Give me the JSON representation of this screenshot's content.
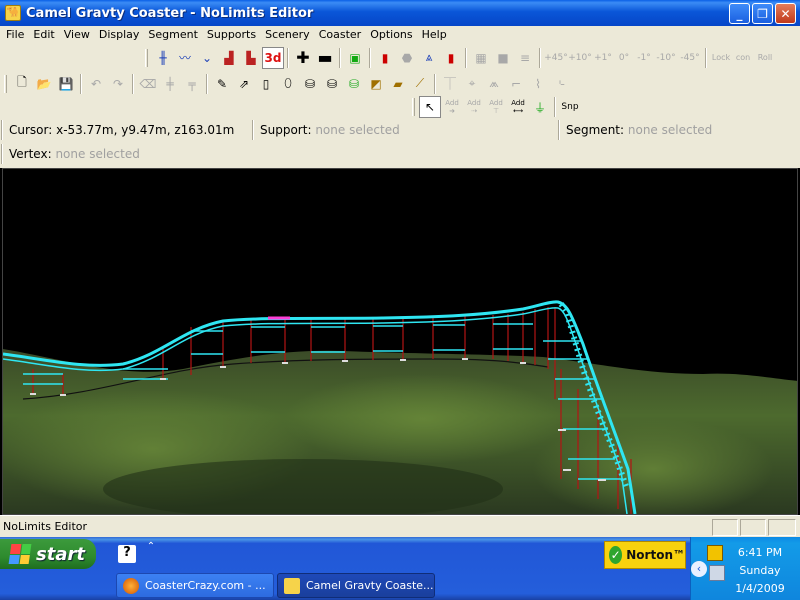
{
  "window": {
    "title": "Camel Gravty Coaster - NoLimits Editor",
    "controls": {
      "minimize": "_",
      "maximize": "❐",
      "close": "✕"
    }
  },
  "menu": {
    "items": [
      "File",
      "Edit",
      "View",
      "Display",
      "Segment",
      "Supports",
      "Scenery",
      "Coaster",
      "Options",
      "Help"
    ]
  },
  "toolbar_top_right": {
    "labels": [
      "+45°",
      "+10°",
      "+1°",
      "0°",
      "-1°",
      "-10°",
      "-45°",
      "Lock",
      "con",
      "Roll"
    ]
  },
  "toolbar3": {
    "add_labels": [
      "Add",
      "Add",
      "Add",
      "Add"
    ],
    "snap_label": "Snp"
  },
  "info": {
    "cursor_label": "Cursor:",
    "cursor_value": "x-53.77m, y9.47m, z163.01m",
    "support_label": "Support:",
    "support_value": "none selected",
    "segment_label": "Segment:",
    "segment_value": "none selected",
    "vertex_label": "Vertex:",
    "vertex_value": "none selected"
  },
  "statusbar": {
    "text": "NoLimits Editor"
  },
  "taskbar": {
    "start_label": "start",
    "tasks": [
      {
        "label": "CoasterCrazy.com - ...",
        "active": false
      },
      {
        "label": "Camel Gravty Coaste...",
        "active": true
      }
    ],
    "norton_label": "Norton™",
    "clock_time": "6:41 PM",
    "clock_day": "Sunday",
    "clock_date": "1/4/2009"
  },
  "colors": {
    "track": "#2fe6f2",
    "supports": "#b31414",
    "ground_dark": "#2c3a1f",
    "ground_light": "#5b7a38",
    "sky": "#000000",
    "highlight": "#ff3fd6"
  }
}
